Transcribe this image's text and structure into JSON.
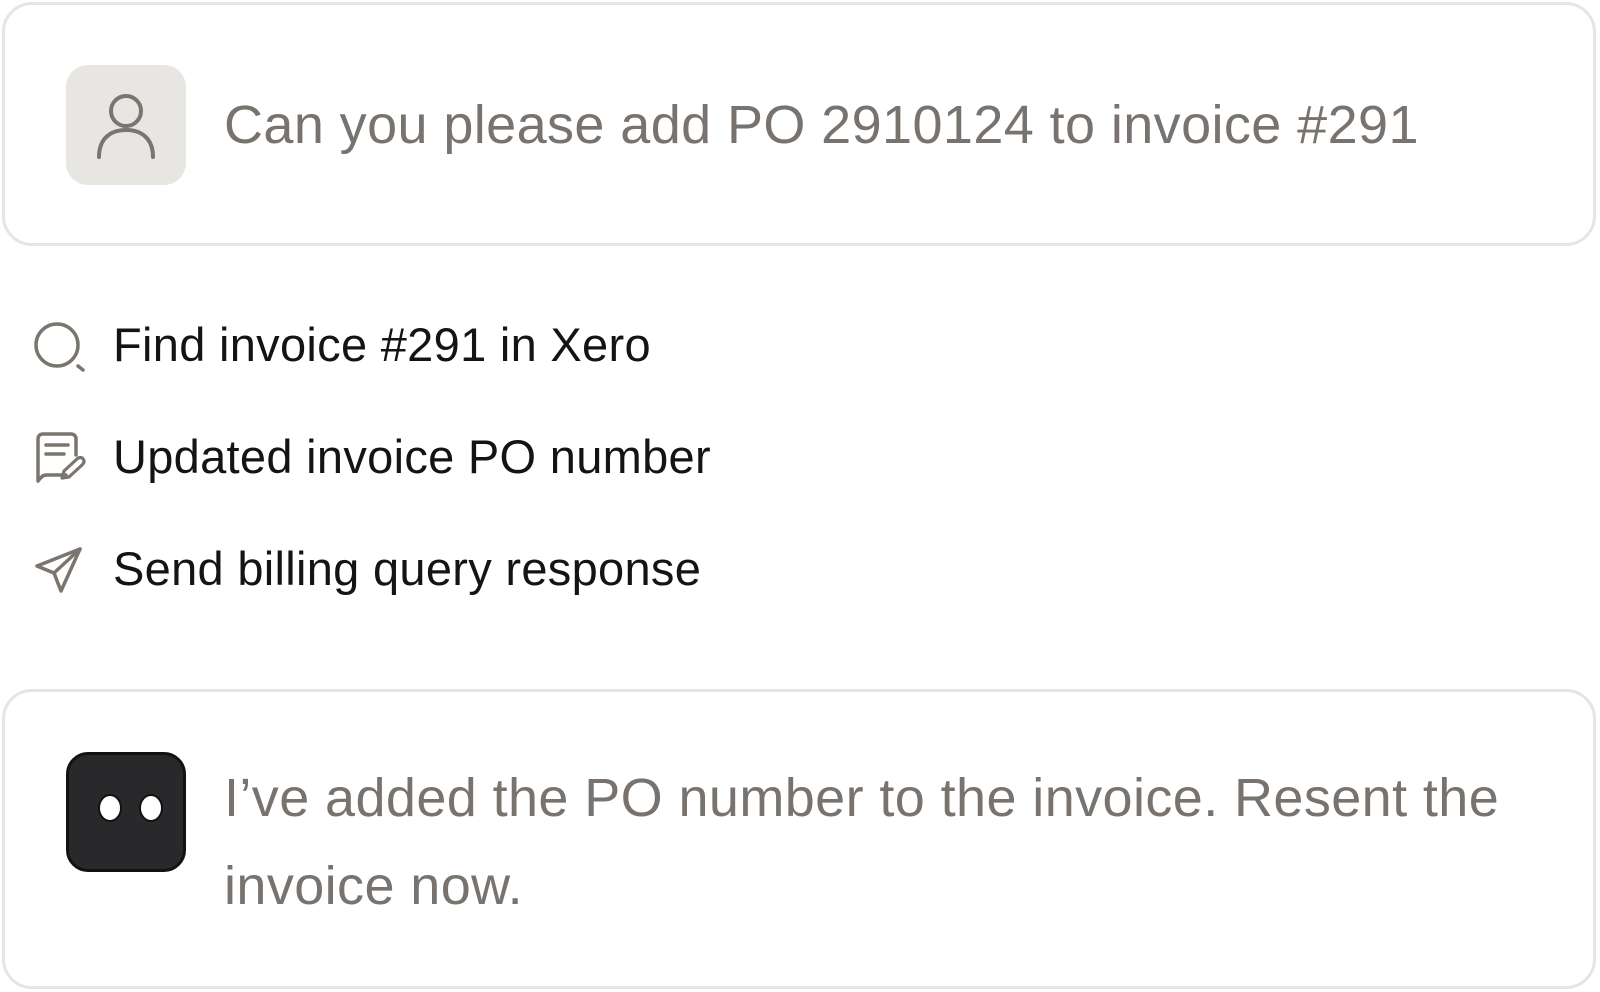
{
  "user_card": {
    "avatar_icon": "user-icon",
    "message": "Can you please add PO 2910124 to invoice #291"
  },
  "steps": [
    {
      "icon": "search-icon",
      "label": "Find invoice #291 in Xero"
    },
    {
      "icon": "edit-document-icon",
      "label": "Updated invoice PO number"
    },
    {
      "icon": "send-icon",
      "label": "Send billing query response"
    }
  ],
  "agent_card": {
    "avatar_icon": "assistant-eyes-icon",
    "message": "I’ve added the PO number to the invoice. Resent the invoice now."
  },
  "colors": {
    "card_border": "#e7e5e3",
    "message_text": "#78736e",
    "step_text": "#141414",
    "icon_stroke": "#7a756f",
    "user_avatar_bg": "#e8e6e3",
    "agent_avatar_bg": "#29292b"
  }
}
